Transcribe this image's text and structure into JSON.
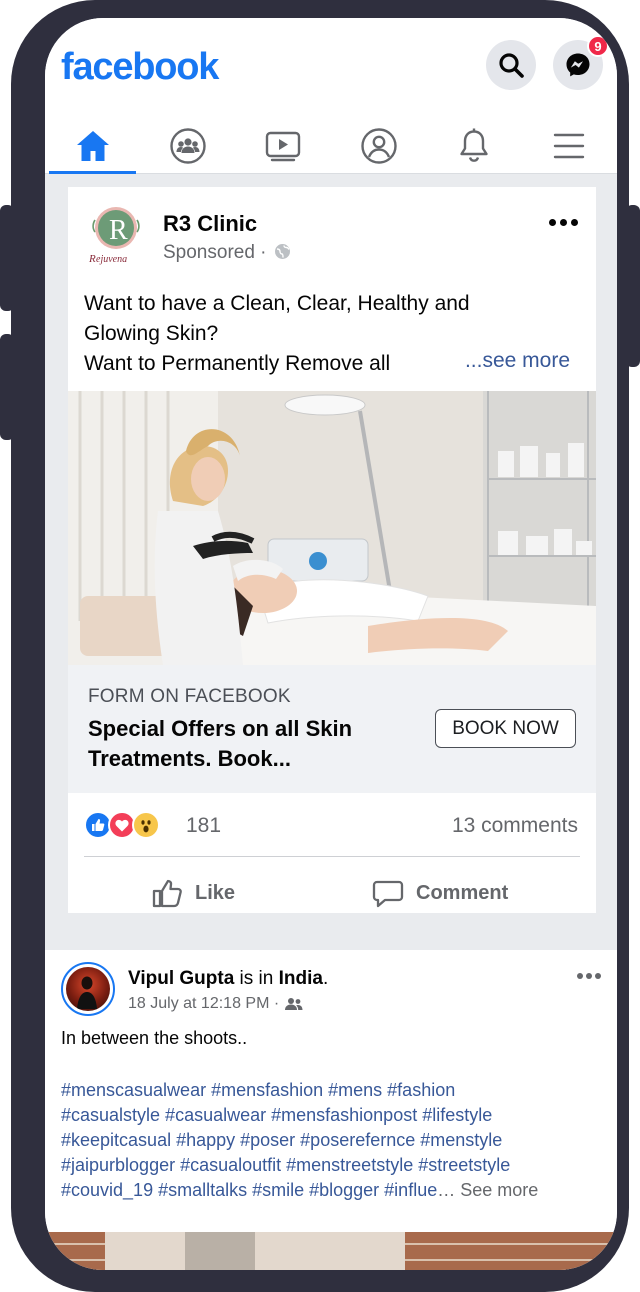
{
  "app": {
    "logo": "facebook",
    "messenger_badge": "9",
    "brand_color": "#1877f2"
  },
  "nav": {
    "tabs": [
      {
        "name": "home",
        "icon": "home-icon",
        "active": true
      },
      {
        "name": "groups",
        "icon": "groups-icon",
        "active": false
      },
      {
        "name": "watch",
        "icon": "video-icon",
        "active": false
      },
      {
        "name": "profile",
        "icon": "profile-icon",
        "active": false
      },
      {
        "name": "notifications",
        "icon": "bell-icon",
        "active": false
      },
      {
        "name": "menu",
        "icon": "hamburger-icon",
        "active": false
      }
    ]
  },
  "sponsored_post": {
    "page_name": "R3 Clinic",
    "subtitle": "Sponsored ·",
    "logo_letter": "R",
    "logo_caption": "ejuvena",
    "text_line1": "Want to have a Clean, Clear, Healthy and",
    "text_line2": "Glowing Skin?",
    "text_line3": "Want to Permanently Remove all",
    "see_more": "...see more",
    "cta_kicker": "FORM ON FACEBOOK",
    "cta_title": "Special Offers on all Skin Treatments. Book...",
    "cta_button": "BOOK NOW",
    "reaction_count": "181",
    "comment_count": "13 comments",
    "like_label": "Like",
    "comment_label": "Comment",
    "reactions": [
      "like-reaction-icon",
      "love-reaction-icon",
      "wow-reaction-icon"
    ]
  },
  "second_post": {
    "author": "Vipul Gupta",
    "is_in": " is in ",
    "location": "India",
    "period": ".",
    "timestamp": "18 July at 12:18 PM ·",
    "caption": "In between the shoots..",
    "hashtags": "#menscasualwear #mensfashion #mens #fashion\n#casualstyle #casualwear #mensfashionpost #lifestyle\n#keepitcasual #happy #poser #poserefernce #menstyle\n#jaipurblogger #casualoutfit #menstreetstyle #streetstyle\n#couvid_19 #smalltalks #smile #blogger #influe",
    "hashtags_see_more": "… See more"
  }
}
